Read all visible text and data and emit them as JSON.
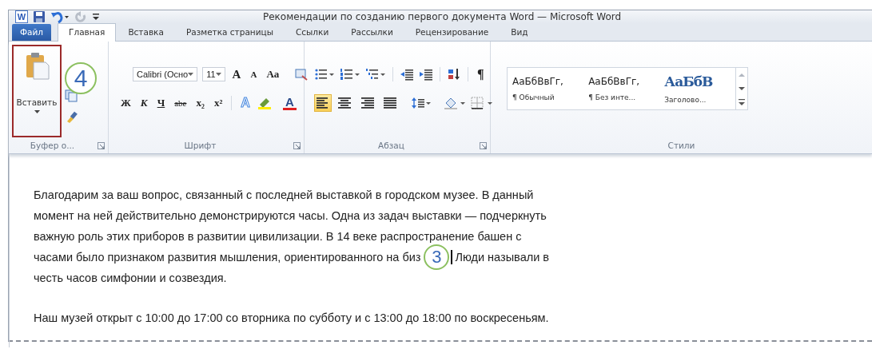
{
  "window": {
    "app_letter": "W",
    "title": "Рекомендации по созданию первого документа Word  — Microsoft Word"
  },
  "tabs": [
    {
      "label": "Файл",
      "kind": "file",
      "selected": false
    },
    {
      "label": "Главная",
      "kind": "tab",
      "selected": true
    },
    {
      "label": "Вставка",
      "kind": "tab",
      "selected": false
    },
    {
      "label": "Разметка страницы",
      "kind": "tab",
      "selected": false
    },
    {
      "label": "Ссылки",
      "kind": "tab",
      "selected": false
    },
    {
      "label": "Рассылки",
      "kind": "tab",
      "selected": false
    },
    {
      "label": "Рецензирование",
      "kind": "tab",
      "selected": false
    },
    {
      "label": "Вид",
      "kind": "tab",
      "selected": false
    }
  ],
  "clipboard": {
    "paste_label": "Вставить",
    "highlighted": true,
    "callout": "4",
    "group_label": "Буфер о..."
  },
  "font": {
    "font_name": "Calibri (Осно",
    "font_size": "11",
    "row1": [
      {
        "label": "A",
        "kind": "grow"
      },
      {
        "label": "A",
        "kind": "shrink"
      },
      {
        "label": "Aa",
        "kind": "case"
      }
    ],
    "row2": [
      {
        "label": "Ж",
        "kind": "bold"
      },
      {
        "label": "К",
        "kind": "italic"
      },
      {
        "label": "Ч",
        "kind": "underline"
      },
      {
        "label": "abe",
        "kind": "strike"
      },
      {
        "label": "x₂",
        "kind": "sub"
      },
      {
        "label": "x²",
        "kind": "sup"
      },
      {
        "label": "A",
        "kind": "effects"
      },
      {
        "label": "A",
        "kind": "color"
      }
    ],
    "group_label": "Шрифт"
  },
  "paragraph": {
    "pilcrow": "¶",
    "alignments": [
      {
        "selected": true
      },
      {
        "selected": false
      },
      {
        "selected": false
      },
      {
        "selected": false
      }
    ],
    "group_label": "Абзац"
  },
  "styles": {
    "items": [
      {
        "sample": "АаБбВвГг,",
        "label": "¶ Обычный",
        "kind": "normal"
      },
      {
        "sample": "АаБбВвГг,",
        "label": "¶ Без инте...",
        "kind": "normal"
      },
      {
        "sample": "АаБбВ",
        "label": "Заголово...",
        "kind": "heading"
      }
    ],
    "group_label": "Стили"
  },
  "document": {
    "paragraphs": [
      {
        "lines": [
          {
            "text": "Благодарим за ваш вопрос, связанный с последней выставкой в городском музее. В данный"
          },
          {
            "text": "момент на ней действительно демонстрируются часы. Одна из задач выставки — подчеркнуть"
          },
          {
            "text": "важную роль этих приборов в развитии цивилизации. В 14 веке распространение башен с"
          },
          {
            "text": "часами было признаком развития мышления, ориентированного на биз",
            "callout": "3",
            "cursor": true,
            "text_after": "Люди называли в"
          },
          {
            "text": "честь часов симфонии и созвездия."
          }
        ]
      },
      {
        "lines": [
          {
            "text": "Наш музей открыт с 10:00 до 17:00 со вторника по субботу и с 13:00 до 18:00 по воскресеньям."
          }
        ]
      }
    ]
  }
}
